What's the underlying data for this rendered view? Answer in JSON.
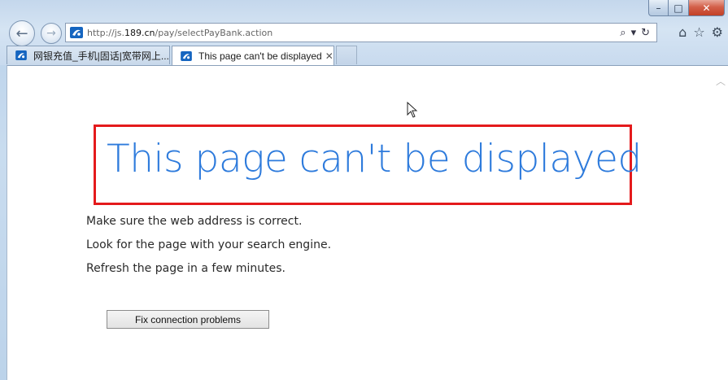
{
  "window": {
    "minimize_label": "–",
    "maximize_label": "□",
    "close_label": "✕"
  },
  "nav": {
    "back_icon": "←",
    "forward_icon": "→"
  },
  "address": {
    "url_prefix": "http://js.",
    "url_host": "189.cn",
    "url_path": "/pay/selectPayBank.action",
    "search_icon": "⌕",
    "dropdown_icon": "▾",
    "refresh_icon": "↻"
  },
  "toolbar": {
    "home_icon": "⌂",
    "favorites_icon": "☆",
    "tools_icon": "⚙"
  },
  "tabs": [
    {
      "label": "网银充值_手机|固话|宽带网上...",
      "active": false
    },
    {
      "label": "This page can't be displayed",
      "active": true,
      "close": "✕"
    }
  ],
  "page": {
    "title": "This page can't be displayed",
    "hints": [
      "Make sure the web address is correct.",
      "Look for the page with your search engine.",
      "Refresh the page in a few minutes."
    ],
    "fix_button": "Fix connection problems"
  },
  "colors": {
    "title_blue": "#2e7bdc",
    "highlight_red": "#e41a1c",
    "brand_189": "#1565c0"
  }
}
